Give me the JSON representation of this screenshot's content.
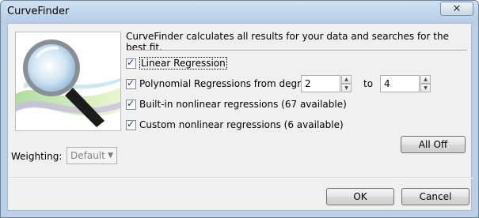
{
  "window": {
    "title": "CurveFinder",
    "close_glyph": "✕"
  },
  "description": "CurveFinder calculates all results for your data and searches for the best fit.",
  "options": [
    {
      "label": "Linear Regression",
      "checked": true
    },
    {
      "label": "Polynomial Regressions from degree",
      "checked": true
    },
    {
      "label": "Built-in nonlinear regressions (67 available)",
      "checked": true
    },
    {
      "label": "Custom nonlinear regressions (6 available)",
      "checked": true
    }
  ],
  "degree": {
    "from": "2",
    "to_label": "to",
    "to": "4"
  },
  "weighting": {
    "label": "Weighting:",
    "value": "Default"
  },
  "buttons": {
    "all_off": "All Off",
    "ok": "OK",
    "cancel": "Cancel"
  },
  "check_glyph": "✓"
}
